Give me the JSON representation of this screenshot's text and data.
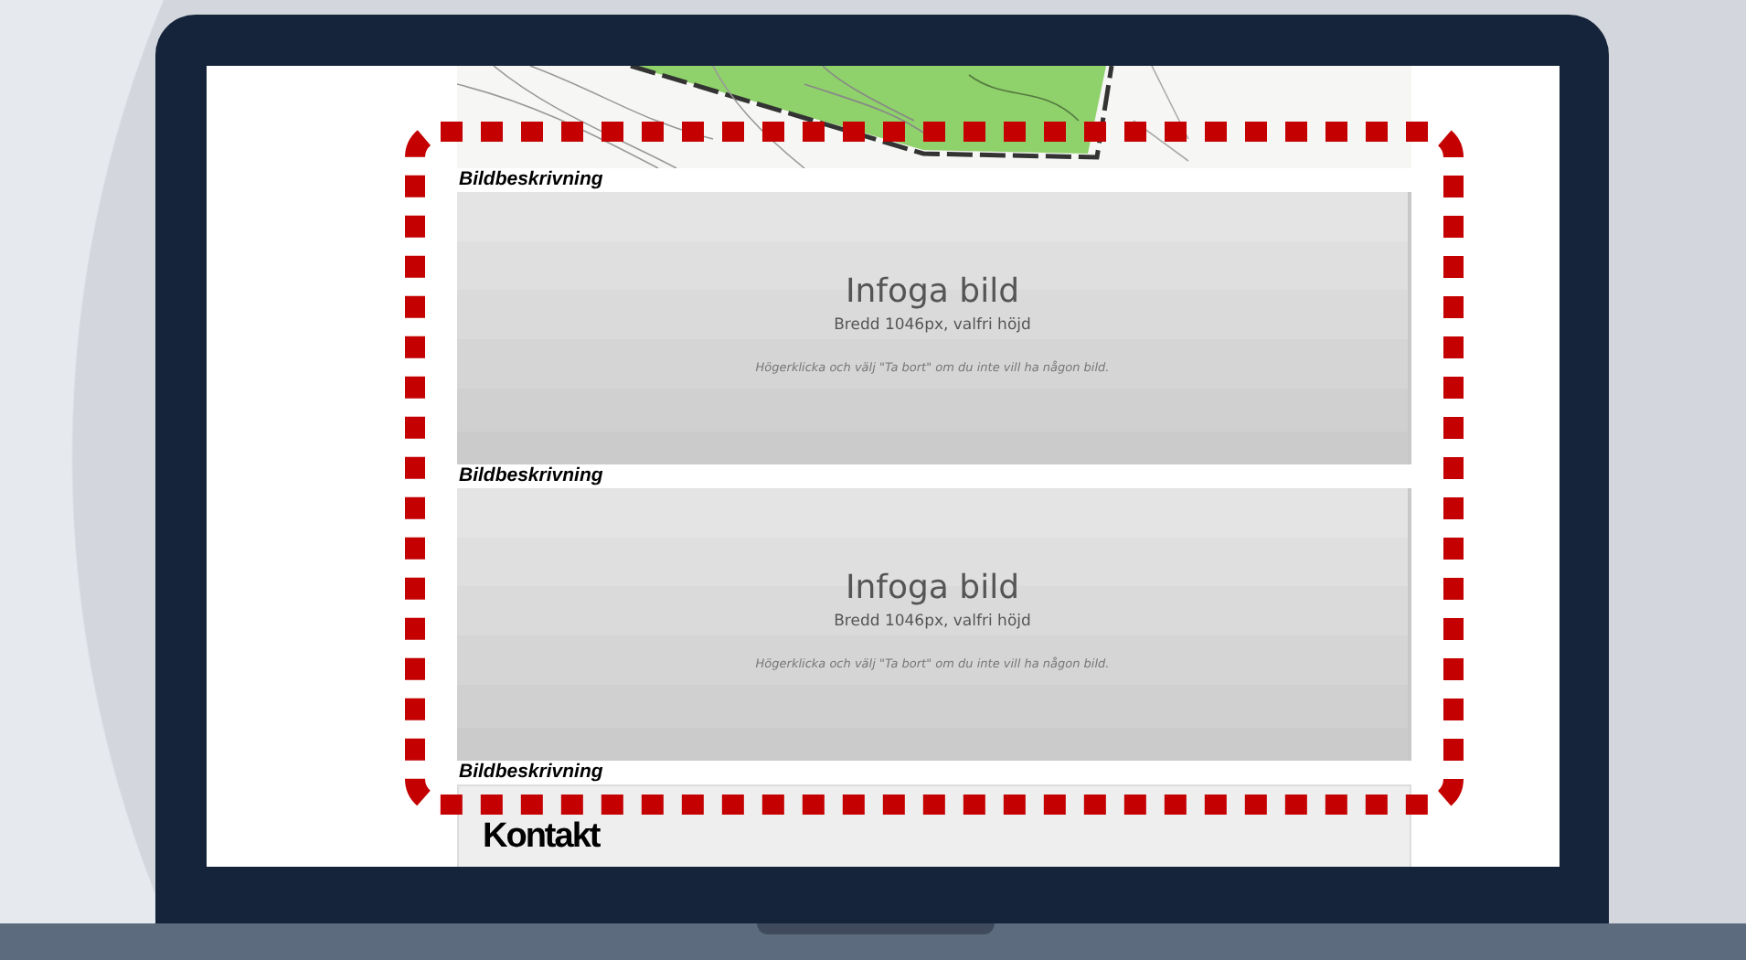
{
  "sections": [
    {
      "kind": "map",
      "caption": "Bildbeskrivning"
    },
    {
      "kind": "image_placeholder",
      "title": "Infoga bild",
      "size_note": "Bredd 1046px, valfri höjd",
      "hint": "Högerklicka och välj \"Ta bort\" om du inte vill ha någon bild.",
      "caption": "Bildbeskrivning"
    },
    {
      "kind": "image_placeholder",
      "title": "Infoga bild",
      "size_note": "Bredd 1046px, valfri höjd",
      "hint": "Högerklicka och välj \"Ta bort\" om du inte vill ha någon bild.",
      "caption": "Bildbeskrivning"
    }
  ],
  "contact": {
    "heading": "Kontakt"
  }
}
